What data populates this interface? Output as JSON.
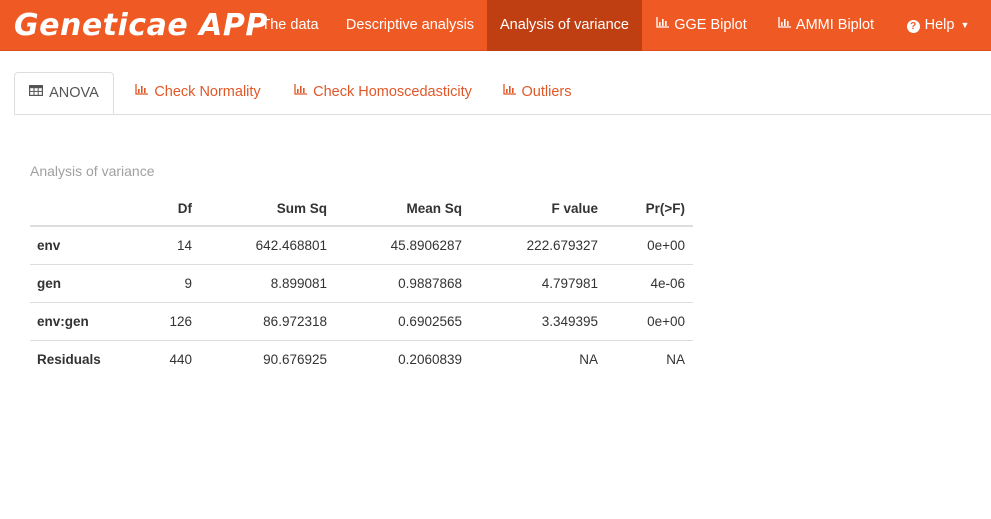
{
  "app": {
    "brand": "Geneticae APP",
    "colors": {
      "navbar": "#ef5a24",
      "navbar_active": "#bf3f12",
      "tab_link": "#e05828"
    }
  },
  "navbar": {
    "items": [
      {
        "label": "The data",
        "icon": null,
        "active": false
      },
      {
        "label": "Descriptive analysis",
        "icon": null,
        "active": false
      },
      {
        "label": "Analysis of variance",
        "icon": null,
        "active": true
      },
      {
        "label": "GGE Biplot",
        "icon": "bar-chart-icon",
        "active": false
      },
      {
        "label": "AMMI Biplot",
        "icon": "bar-chart-icon",
        "active": false
      },
      {
        "label": "Help",
        "icon": "question-circle-icon",
        "active": false,
        "dropdown": true
      }
    ]
  },
  "tabs": [
    {
      "label": "ANOVA",
      "icon": "table-icon",
      "active": true
    },
    {
      "label": "Check Normality",
      "icon": "bar-chart-icon",
      "active": false
    },
    {
      "label": "Check Homoscedasticity",
      "icon": "bar-chart-icon",
      "active": false
    },
    {
      "label": "Outliers",
      "icon": "bar-chart-icon",
      "active": false
    }
  ],
  "section": {
    "caption": "Analysis of variance"
  },
  "table": {
    "columns": [
      "",
      "Df",
      "Sum Sq",
      "Mean Sq",
      "F value",
      "Pr(>F)"
    ],
    "rows": [
      {
        "name": "env",
        "df": "14",
        "sum_sq": "642.468801",
        "mean_sq": "45.8906287",
        "f_value": "222.679327",
        "pr_f": "0e+00"
      },
      {
        "name": "gen",
        "df": "9",
        "sum_sq": "8.899081",
        "mean_sq": "0.9887868",
        "f_value": "4.797981",
        "pr_f": "4e-06"
      },
      {
        "name": "env:gen",
        "df": "126",
        "sum_sq": "86.972318",
        "mean_sq": "0.6902565",
        "f_value": "3.349395",
        "pr_f": "0e+00"
      },
      {
        "name": "Residuals",
        "df": "440",
        "sum_sq": "90.676925",
        "mean_sq": "0.2060839",
        "f_value": "NA",
        "pr_f": "NA"
      }
    ]
  }
}
